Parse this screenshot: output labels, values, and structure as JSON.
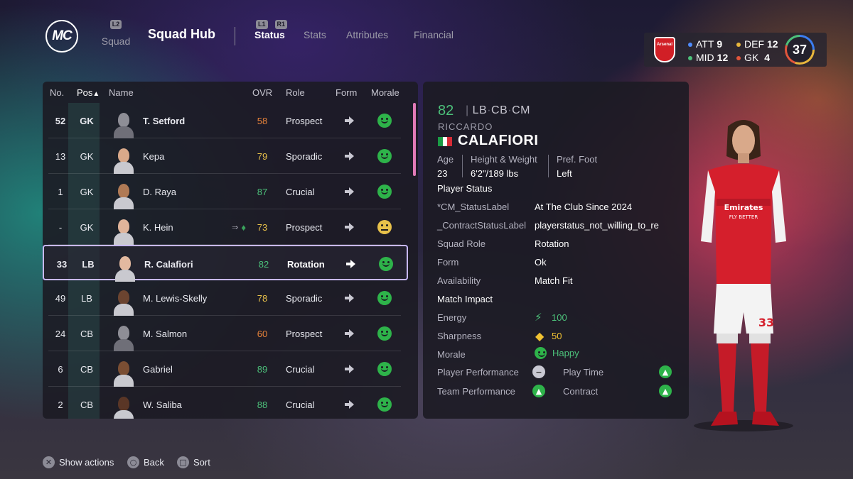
{
  "nav": {
    "logo_text": "MC",
    "squad_hint": "L2",
    "squad_label": "Squad",
    "title": "Squad Hub",
    "tab_hint_left": "L1",
    "tab_hint_right": "R1",
    "tabs": [
      {
        "label": "Status",
        "active": true
      },
      {
        "label": "Stats",
        "active": false
      },
      {
        "label": "Attributes",
        "active": false
      },
      {
        "label": "Financial",
        "active": false
      }
    ]
  },
  "team_summary": {
    "crest_text": "Arsenal",
    "att_label": "ATT",
    "att_value": "9",
    "def_label": "DEF",
    "def_value": "12",
    "mid_label": "MID",
    "mid_value": "12",
    "gk_label": "GK",
    "gk_value": "4",
    "overall": "37",
    "colors": {
      "att": "#4f8cff",
      "def": "#e8b63c",
      "mid": "#4cc07a",
      "gk": "#e2553b"
    }
  },
  "table": {
    "headers": {
      "no": "No.",
      "pos": "Pos",
      "pos_sort": "▲",
      "name": "Name",
      "ovr": "OVR",
      "role": "Role",
      "form": "Form",
      "morale": "Morale"
    },
    "rows": [
      {
        "no": "52",
        "pos": "GK",
        "name": "T. Setford",
        "ovr": "58",
        "role": "Prospect",
        "morale": "happy",
        "extra": "",
        "avatar": "placeholder"
      },
      {
        "no": "13",
        "pos": "GK",
        "name": "Kepa",
        "ovr": "79",
        "role": "Sporadic",
        "morale": "happy",
        "extra": "",
        "avatar": "photo"
      },
      {
        "no": "1",
        "pos": "GK",
        "name": "D. Raya",
        "ovr": "87",
        "role": "Crucial",
        "morale": "happy",
        "extra": "",
        "avatar": "photo"
      },
      {
        "no": "-",
        "pos": "GK",
        "name": "K. Hein",
        "ovr": "73",
        "role": "Prospect",
        "morale": "neutral",
        "extra": "loan",
        "avatar": "photo"
      },
      {
        "no": "33",
        "pos": "LB",
        "name": "R. Calafiori",
        "ovr": "82",
        "role": "Rotation",
        "morale": "happy",
        "extra": "",
        "avatar": "photo",
        "selected": true
      },
      {
        "no": "49",
        "pos": "LB",
        "name": "M. Lewis-Skelly",
        "ovr": "78",
        "role": "Sporadic",
        "morale": "happy",
        "extra": "",
        "avatar": "photo"
      },
      {
        "no": "24",
        "pos": "CB",
        "name": "M. Salmon",
        "ovr": "60",
        "role": "Prospect",
        "morale": "happy",
        "extra": "",
        "avatar": "placeholder"
      },
      {
        "no": "6",
        "pos": "CB",
        "name": "Gabriel",
        "ovr": "89",
        "role": "Crucial",
        "morale": "happy",
        "extra": "",
        "avatar": "photo"
      },
      {
        "no": "2",
        "pos": "CB",
        "name": "W. Saliba",
        "ovr": "88",
        "role": "Crucial",
        "morale": "happy",
        "extra": "",
        "avatar": "photo"
      }
    ],
    "ovr_colors": {
      "high": "#4cc07a",
      "mid": "#e8c14a",
      "low": "#e8833a"
    }
  },
  "detail": {
    "ovr": "82",
    "positions": [
      "LB",
      "CB",
      "CM"
    ],
    "first_name": "RICCARDO",
    "last_name": "CALAFIORI",
    "age_label": "Age",
    "age": "23",
    "hw_label": "Height & Weight",
    "hw": "6'2\"/189 lbs",
    "foot_label": "Pref. Foot",
    "foot": "Left",
    "status_title": "Player Status",
    "status_rows": [
      {
        "k": "*CM_StatusLabel",
        "v": "At The Club Since 2024"
      },
      {
        "k": "_ContractStatusLabel",
        "v": "playerstatus_not_willing_to_re"
      },
      {
        "k": "Squad Role",
        "v": "Rotation"
      },
      {
        "k": "Form",
        "v": "Ok"
      },
      {
        "k": "Availability",
        "v": "Match Fit"
      }
    ],
    "impact_title": "Match Impact",
    "energy_label": "Energy",
    "energy": "100",
    "sharpness_label": "Sharpness",
    "sharpness": "50",
    "morale_label": "Morale",
    "morale": "Happy",
    "player_perf_label": "Player Performance",
    "team_perf_label": "Team Performance",
    "play_time_label": "Play Time",
    "contract_label": "Contract"
  },
  "hints": {
    "show_actions": "Show actions",
    "back": "Back",
    "sort": "Sort"
  }
}
